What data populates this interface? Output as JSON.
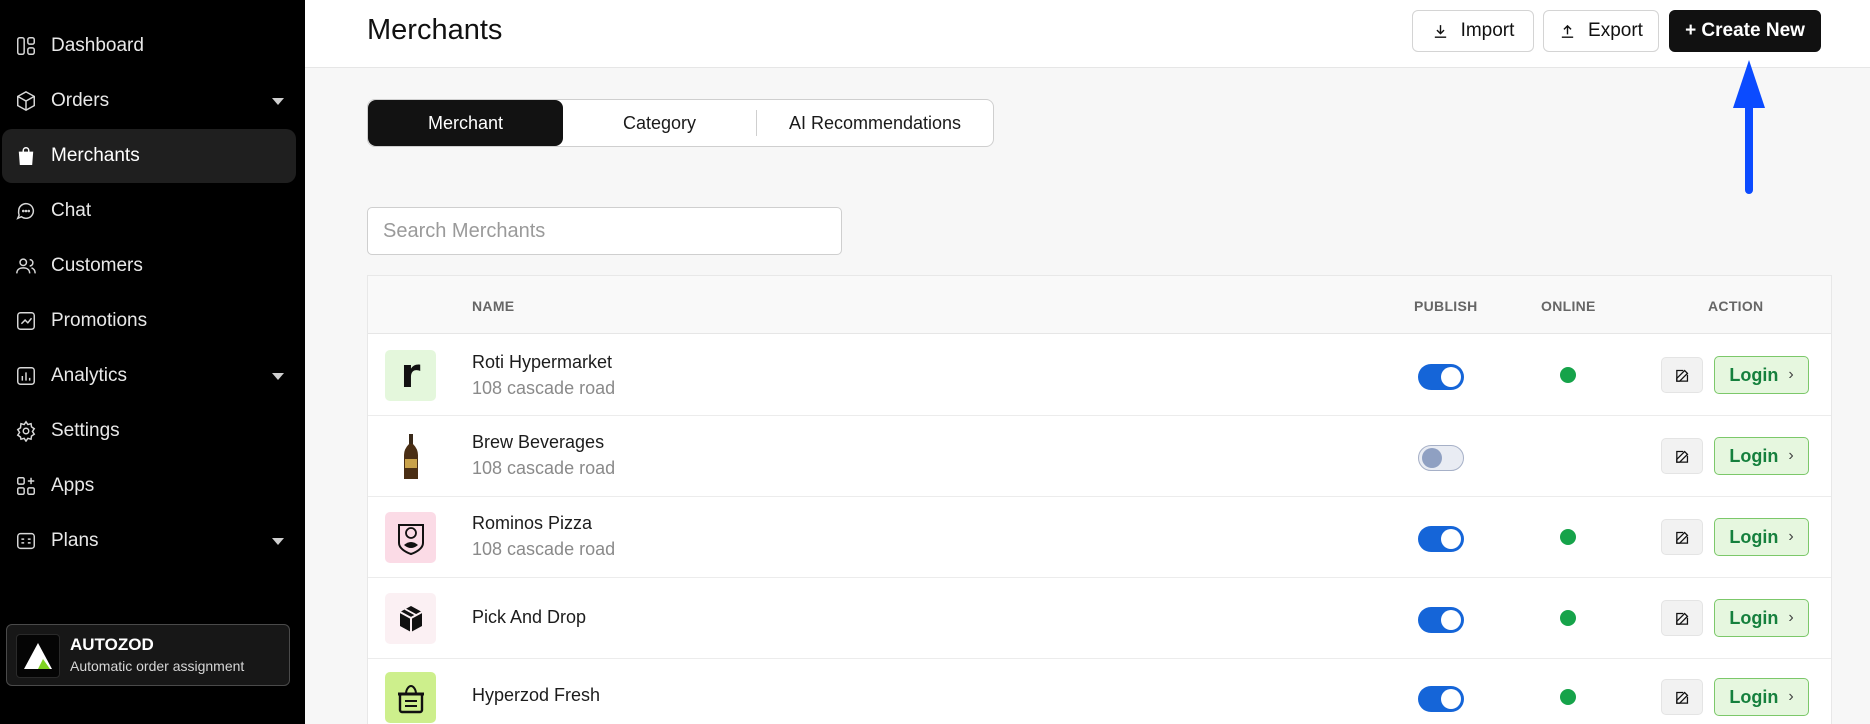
{
  "sidebar": {
    "items": [
      {
        "label": "Dashboard",
        "icon": "dashboard-icon",
        "caret": false
      },
      {
        "label": "Orders",
        "icon": "box-icon",
        "caret": true
      },
      {
        "label": "Merchants",
        "icon": "shopping-bag-icon",
        "caret": false,
        "active": true
      },
      {
        "label": "Chat",
        "icon": "chat-icon",
        "caret": false
      },
      {
        "label": "Customers",
        "icon": "users-icon",
        "caret": false
      },
      {
        "label": "Promotions",
        "icon": "trend-icon",
        "caret": false
      },
      {
        "label": "Analytics",
        "icon": "bar-chart-icon",
        "caret": true
      },
      {
        "label": "Settings",
        "icon": "gear-icon",
        "caret": false
      },
      {
        "label": "Apps",
        "icon": "apps-grid-icon",
        "caret": false
      },
      {
        "label": "Plans",
        "icon": "plans-icon",
        "caret": true
      }
    ],
    "promo": {
      "title": "AUTOZOD",
      "subtitle": "Automatic order assignment"
    }
  },
  "header": {
    "title": "Merchants",
    "import_label": "Import",
    "export_label": "Export",
    "create_label": "+ Create New"
  },
  "tabs": [
    {
      "label": "Merchant",
      "active": true
    },
    {
      "label": "Category",
      "active": false
    },
    {
      "label": "AI Recommendations",
      "active": false
    }
  ],
  "search": {
    "placeholder": "Search Merchants",
    "value": ""
  },
  "table": {
    "columns": {
      "name": "NAME",
      "publish": "PUBLISH",
      "online": "ONLINE",
      "action": "ACTION"
    },
    "login_label": "Login",
    "rows": [
      {
        "name": "Roti Hypermarket",
        "address": "108 cascade road",
        "publish": true,
        "online": true,
        "avatar": "letter-r-logo"
      },
      {
        "name": "Brew Beverages",
        "address": "108 cascade road",
        "publish": false,
        "online": false,
        "avatar": "bottle-logo"
      },
      {
        "name": "Rominos Pizza",
        "address": "108 cascade road",
        "publish": true,
        "online": true,
        "avatar": "pizza-badge-logo"
      },
      {
        "name": "Pick And Drop",
        "address": "",
        "publish": true,
        "online": true,
        "avatar": "cube-logo"
      },
      {
        "name": "Hyperzod Fresh",
        "address": "",
        "publish": true,
        "online": true,
        "avatar": "basket-logo"
      }
    ]
  },
  "colors": {
    "accent_blue": "#1565d8",
    "online_green": "#16a34a",
    "login_green": "#15803d",
    "annotation_arrow": "#0b4bff"
  }
}
